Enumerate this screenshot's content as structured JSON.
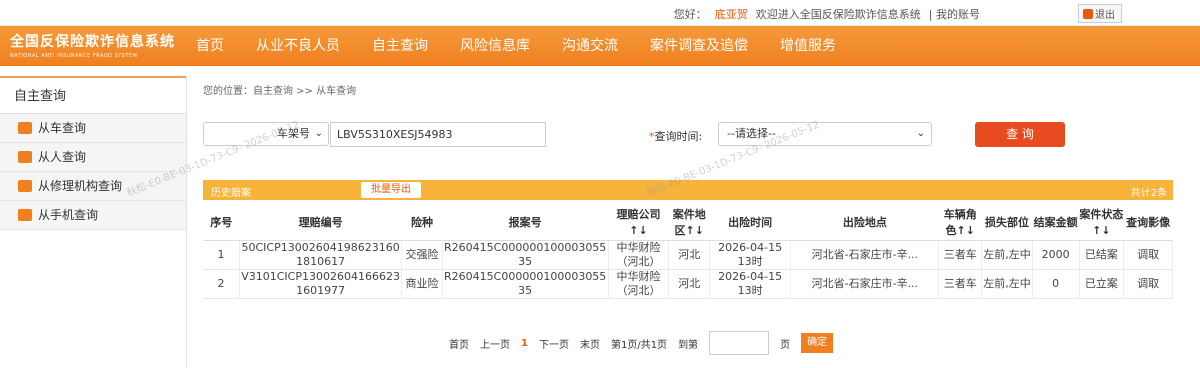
{
  "topbar": {
    "greeting": "您好：",
    "user_name": "底亚贺",
    "welcome": "欢迎进入全国反保险欺诈信息系统",
    "my_account": "| 我的账号",
    "logout": "退出"
  },
  "header": {
    "logo_cn": "全国反保险欺诈信息系统",
    "logo_en": "NATIONAL ANTI INSURANCE FRAUD SYSTEM",
    "nav": [
      "首页",
      "从业不良人员",
      "自主查询",
      "风险信息库",
      "沟通交流",
      "案件调查及追偿",
      "增值服务"
    ]
  },
  "sidebar": {
    "title": "自主查询",
    "items": [
      {
        "label": "从车查询",
        "icon": "car-icon",
        "active": true
      },
      {
        "label": "从人查询",
        "icon": "person-icon"
      },
      {
        "label": "从修理机构查询",
        "icon": "repair-icon"
      },
      {
        "label": "从手机查询",
        "icon": "phone-icon"
      }
    ]
  },
  "breadcrumb": "您的位置：自主查询 >> 从车查询",
  "search": {
    "type_selected": "车架号",
    "vin_value": "LBV5S310XESJ54983",
    "time_label": "查询时间:",
    "time_selected": "--请选择--",
    "query_button": "查 询"
  },
  "results": {
    "title": "历史赔案",
    "export_button": "批量导出",
    "total": "共计2条",
    "columns": [
      "序号",
      "理赔编号",
      "险种",
      "报案号",
      "理赔公司↑↓",
      "案件地区↑↓",
      "出险时间",
      "出险地点",
      "车辆角色↑↓",
      "损失部位",
      "结案金额",
      "案件状态↑↓",
      "查询影像"
    ],
    "rows": [
      [
        "1",
        "50CICP13002604198623160 1810617",
        "交强险",
        "R260415C000000100003055 35",
        "中华财险（河北）",
        "河北",
        "2026-04-15 13时",
        "河北省-石家庄市-辛...",
        "三者车",
        "左前,左中",
        "2000",
        "已结案",
        "调取"
      ],
      [
        "2",
        "V3101CICP13002604166623 1601977",
        "商业险",
        "R260415C000000100003055 35",
        "中华财险（河北）",
        "河北",
        "2026-04-15 13时",
        "河北省-石家庄市-辛...",
        "三者车",
        "左前,左中",
        "0",
        "已立案",
        "调取"
      ]
    ]
  },
  "pager": {
    "first": "首页",
    "prev": "上一页",
    "current": "1",
    "next": "下一页",
    "last": "末页",
    "info": "第1页/共1页",
    "goto": "到第",
    "page_unit": "页",
    "confirm": "确定"
  },
  "watermark": "秋松-E0-BE-03-1D-73-C9- 2026-05-12",
  "colors": {
    "brand": "#f07f1f",
    "accent": "#e84b1f",
    "panel": "#f7b33a"
  }
}
